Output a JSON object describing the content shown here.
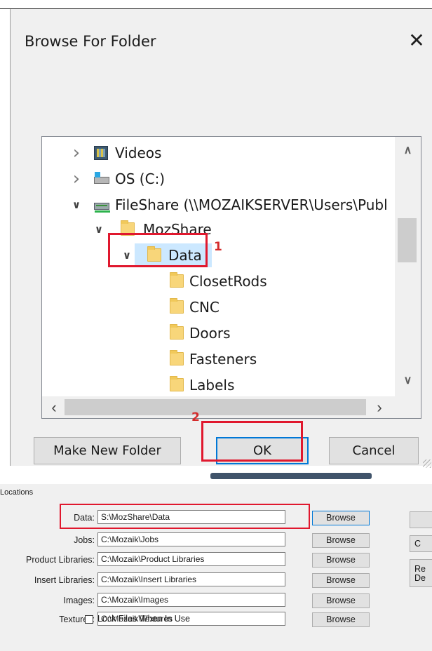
{
  "dialog": {
    "title": "Browse For Folder",
    "tree": [
      {
        "label": "Videos",
        "icon": "video-icon",
        "expander": "collapsed"
      },
      {
        "label": "OS (C:)",
        "icon": "drive-icon",
        "expander": "collapsed"
      },
      {
        "label": "FileShare (\\\\MOZAIKSERVER\\Users\\Publ",
        "icon": "network-drive-icon",
        "expander": "expanded"
      },
      {
        "label": "MozShare",
        "icon": "folder-icon",
        "expander": "expanded"
      },
      {
        "label": "Data",
        "icon": "folder-icon",
        "expander": "expanded",
        "selected": true
      },
      {
        "label": "ClosetRods",
        "icon": "folder-icon"
      },
      {
        "label": "CNC",
        "icon": "folder-icon"
      },
      {
        "label": "Doors",
        "icon": "folder-icon"
      },
      {
        "label": "Fasteners",
        "icon": "folder-icon"
      },
      {
        "label": "Labels",
        "icon": "folder-icon"
      }
    ],
    "buttons": {
      "make_new_folder": "Make New Folder",
      "ok": "OK",
      "cancel": "Cancel"
    },
    "annotations": {
      "step1": "1",
      "step2": "2"
    },
    "colors": {
      "annotation": "#e0182e",
      "selection": "#cce8ff",
      "focus": "#0078d7"
    }
  },
  "locations": {
    "title": "Locations",
    "rows": [
      {
        "label": "Data:",
        "value": "S:\\MozShare\\Data",
        "button": "Browse"
      },
      {
        "label": "Jobs:",
        "value": "C:\\Mozaik\\Jobs",
        "button": "Browse"
      },
      {
        "label": "Product Libraries:",
        "value": "C:\\Mozaik\\Product Libraries",
        "button": "Browse"
      },
      {
        "label": "Insert Libraries:",
        "value": "C:\\Mozaik\\Insert Libraries",
        "button": "Browse"
      },
      {
        "label": "Images:",
        "value": "C:\\Mozaik\\Images",
        "button": "Browse"
      },
      {
        "label": "Textures:",
        "value": "C:\\Mozaik\\Textures",
        "button": "Browse"
      }
    ],
    "side_buttons": [
      "",
      "C",
      "Re\nDe"
    ],
    "lock_files": {
      "label": "Lock Files When In Use",
      "checked": false
    }
  }
}
